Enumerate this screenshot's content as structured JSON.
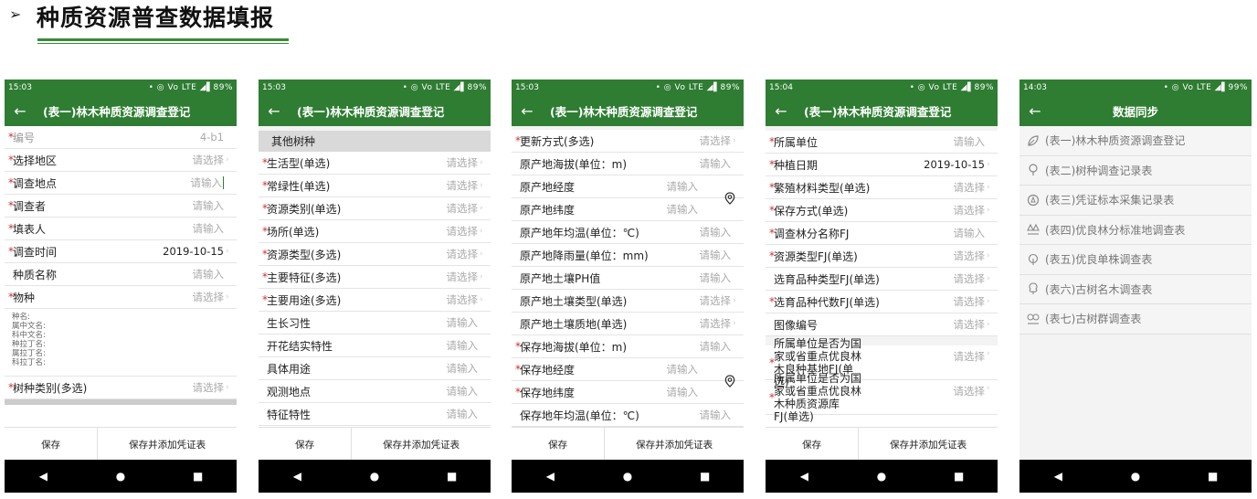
{
  "header": {
    "arrow": "➢",
    "title": "种质资源普查数据填报"
  },
  "phones": [
    {
      "status": {
        "time": "15:03",
        "icons": "• ◎ Vo LTE ◢▌89%"
      },
      "title": "(表一)林木种质资源调查登记",
      "rows": [
        {
          "req": "*",
          "label": "编号",
          "value": "4-b1"
        },
        {
          "req": "*",
          "label": "选择地区",
          "value": "请选择"
        },
        {
          "req": "*",
          "label": "调查地点",
          "value": "请输入"
        },
        {
          "req": "*",
          "label": "调查者",
          "value": "请输入"
        },
        {
          "req": "*",
          "label": "填表人",
          "value": "请输入"
        },
        {
          "req": "*",
          "label": "调查时间",
          "value": "2019-10-15"
        },
        {
          "req": "",
          "label": "种质名称",
          "value": "请输入"
        },
        {
          "req": "*",
          "label": "物种",
          "value": "请选择"
        }
      ],
      "info_lines": [
        "种名:",
        "属中文名:",
        "科中文名:",
        "种拉丁名:",
        "属拉丁名:",
        "科拉丁名:"
      ],
      "last_row": {
        "req": "*",
        "label": "树种类别(多选)",
        "value": "请选择"
      },
      "buttons": {
        "save": "保存",
        "save_add": "保存并添加凭证表"
      }
    },
    {
      "status": {
        "time": "15:03",
        "icons": "• ◎ Vo LTE ◢▌89%"
      },
      "title": "(表一)林木种质资源调查登记",
      "section": "其他树种",
      "rows": [
        {
          "req": "*",
          "label": "生活型(单选)",
          "value": "请选择"
        },
        {
          "req": "*",
          "label": "常绿性(单选)",
          "value": "请选择"
        },
        {
          "req": "*",
          "label": "资源类别(单选)",
          "value": "请选择"
        },
        {
          "req": "*",
          "label": "场所(单选)",
          "value": "请选择"
        },
        {
          "req": "*",
          "label": "资源类型(多选)",
          "value": "请选择"
        },
        {
          "req": "*",
          "label": "主要特征(多选)",
          "value": "请选择"
        },
        {
          "req": "*",
          "label": "主要用途(多选)",
          "value": "请选择"
        },
        {
          "req": "",
          "label": "生长习性",
          "value": "请输入"
        },
        {
          "req": "",
          "label": "开花结实特性",
          "value": "请输入"
        },
        {
          "req": "",
          "label": "具体用途",
          "value": "请输入"
        },
        {
          "req": "",
          "label": "观测地点",
          "value": "请输入"
        },
        {
          "req": "",
          "label": "特征特性",
          "value": "请输入"
        }
      ],
      "buttons": {
        "save": "保存",
        "save_add": "保存并添加凭证表"
      }
    },
    {
      "status": {
        "time": "15:03",
        "icons": "• ◎ Vo LTE ◢▌89%"
      },
      "title": "(表一)林木种质资源调查登记",
      "rows": [
        {
          "req": "*",
          "label": "更新方式(多选)",
          "value": "请选择"
        },
        {
          "req": "",
          "label": "原产地海拔(单位：m)",
          "value": "请输入"
        },
        {
          "req": "",
          "label": "原产地经度",
          "value": "请输入"
        },
        {
          "req": "",
          "label": "原产地纬度",
          "value": "请输入"
        },
        {
          "req": "",
          "label": "原产地年均温(单位：℃)",
          "value": "请输入"
        },
        {
          "req": "",
          "label": "原产地降雨量(单位：mm)",
          "value": "请输入"
        },
        {
          "req": "",
          "label": "原产地土壤PH值",
          "value": "请输入"
        },
        {
          "req": "",
          "label": "原产地土壤类型(单选)",
          "value": "请选择"
        },
        {
          "req": "",
          "label": "原产地土壤质地(单选)",
          "value": "请选择"
        },
        {
          "req": "*",
          "label": "保存地海拔(单位：m)",
          "value": "请输入"
        },
        {
          "req": "*",
          "label": "保存地经度",
          "value": "请输入"
        },
        {
          "req": "*",
          "label": "保存地纬度",
          "value": "请输入"
        },
        {
          "req": "",
          "label": "保存地年均温(单位：℃)",
          "value": "请输入"
        }
      ],
      "buttons": {
        "save": "保存",
        "save_add": "保存并添加凭证表"
      }
    },
    {
      "status": {
        "time": "15:04",
        "icons": "• ◎ Vo LTE ◢▌89%"
      },
      "title": "(表一)林木种质资源调查登记",
      "rows": [
        {
          "req": "*",
          "label": "所属单位",
          "value": "请输入"
        },
        {
          "req": "*",
          "label": "种植日期",
          "value": "2019-10-15"
        },
        {
          "req": "*",
          "label": "繁殖材料类型(单选)",
          "value": "请选择"
        },
        {
          "req": "*",
          "label": "保存方式(单选)",
          "value": "请选择"
        },
        {
          "req": "*",
          "label": "调查林分名称FJ",
          "value": "请输入"
        },
        {
          "req": "*",
          "label": "资源类型FJ(单选)",
          "value": "请选择"
        },
        {
          "req": "",
          "label": "选育品种类型FJ(单选)",
          "value": "请选择"
        },
        {
          "req": "*",
          "label": "选育品种代数FJ(单选)",
          "value": "请选择"
        },
        {
          "req": "",
          "label": "图像编号",
          "value": "请选择"
        }
      ],
      "tall_rows": [
        {
          "req": "*",
          "label": "所属单位是否为国家或省重点优良林木良种基地FJ(单选)",
          "value": "请选择"
        },
        {
          "req": "*",
          "label": "所属单位是否为国家或省重点优良林木种质资源库FJ(单选)",
          "value": "请选择"
        }
      ],
      "buttons": {
        "save": "保存",
        "save_add": "保存并添加凭证表"
      }
    },
    {
      "status": {
        "time": "14:03",
        "icons": "• ◎ Vo LTE ◢▌99%"
      },
      "title": "数据同步",
      "items": [
        "(表一)林木种质资源调查登记",
        "(表二)树种调查记录表",
        "(表三)凭证标本采集记录表",
        "(表四)优良林分标准地调查表",
        "(表五)优良单株调查表",
        "(表六)古树名木调查表",
        "(表七)古树群调查表"
      ]
    }
  ],
  "nav": {
    "back": "◀",
    "home": "●",
    "recent": "■"
  },
  "colors": {
    "green": "#2e7d32",
    "required": "#d32f2f",
    "placeholder": "#aaaaaa"
  }
}
